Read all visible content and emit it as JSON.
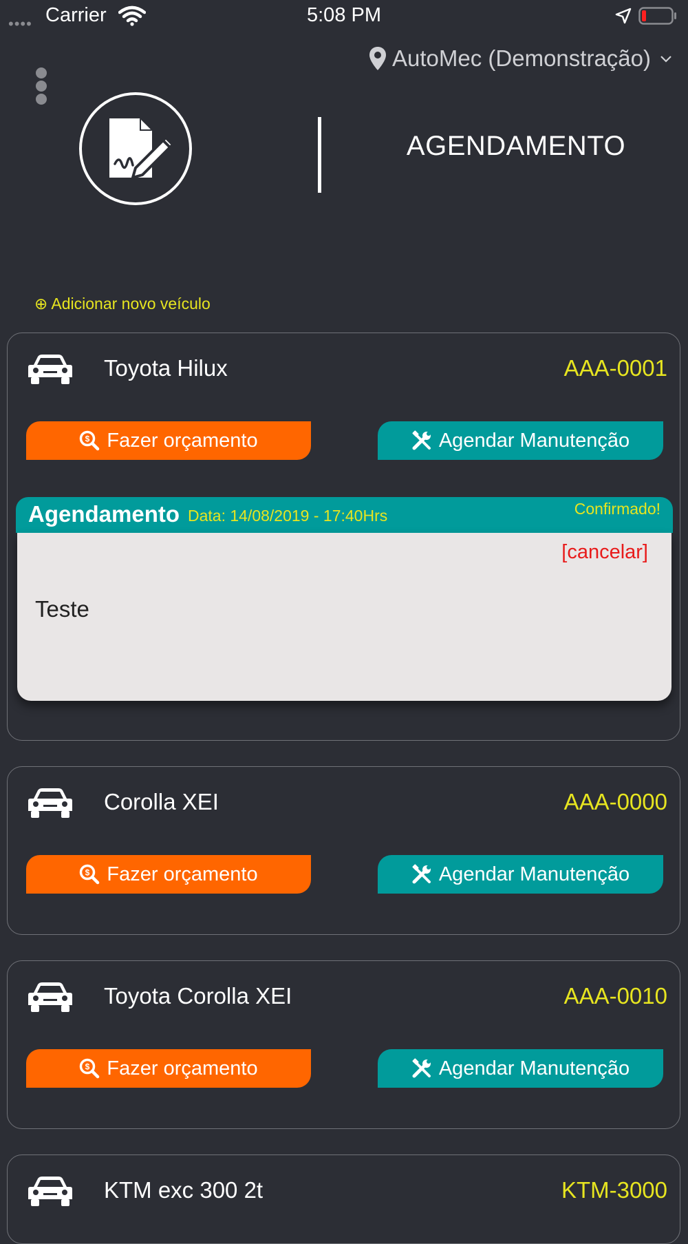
{
  "status_bar": {
    "signal": "••••",
    "carrier": "Carrier",
    "time": "5:08 PM"
  },
  "header": {
    "location": "AutoMec (Demonstração)",
    "title": "AGENDAMENTO",
    "icons": [
      "map-pin-icon",
      "chevron-down-icon",
      "kebab-menu-icon",
      "document-sign-icon"
    ]
  },
  "add_vehicle_label": "⊕ Adicionar novo veículo",
  "buttons": {
    "quote_label": "Fazer orçamento",
    "schedule_label": "Agendar Manutenção"
  },
  "vehicles": [
    {
      "name": "Toyota Hilux",
      "plate": "AAA-0001",
      "appointment": {
        "title": "Agendamento",
        "date": "Data: 14/08/2019 - 17:40Hrs",
        "status": "Confirmado!",
        "cancel_label": "[cancelar]",
        "note": "Teste"
      }
    },
    {
      "name": "Corolla XEI",
      "plate": "AAA-0000"
    },
    {
      "name": "Toyota Corolla XEI",
      "plate": "AAA-0010"
    },
    {
      "name": "KTM exc 300 2t",
      "plate": "KTM-3000"
    }
  ],
  "colors": {
    "background": "#2c2e35",
    "accent_yellow": "#e7e520",
    "orange": "#ff6600",
    "teal": "#019b9b",
    "danger_red": "#e81b1b",
    "card_border": "#707278"
  }
}
